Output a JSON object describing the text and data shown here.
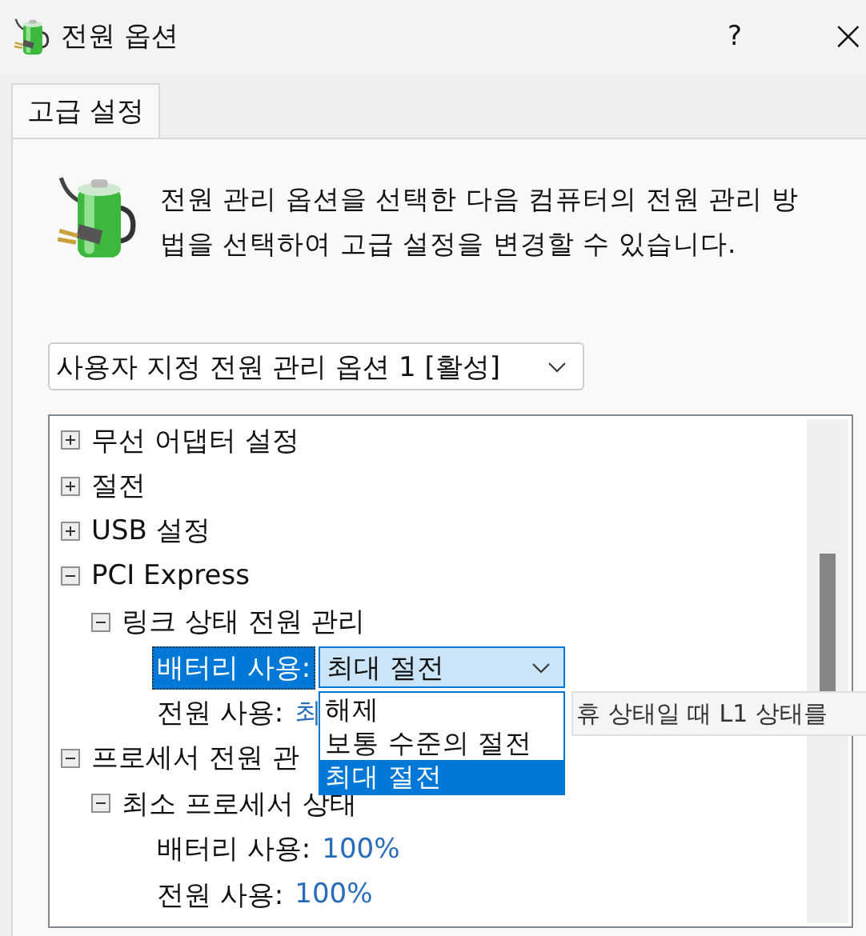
{
  "window": {
    "title": "전원 옵션",
    "help": "?",
    "close": "×"
  },
  "tabs": [
    {
      "label": "고급 설정",
      "selected": true
    }
  ],
  "description": "전원 관리 옵션을 선택한 다음 컴퓨터의 전원 관리 방법을 선택하여 고급 설정을 변경할 수 있습니다.",
  "plan_select": {
    "value": "사용자 지정 전원 관리 옵션 1 [활성]"
  },
  "tree": {
    "items": [
      {
        "kind": "group",
        "label": "무선 어댑터 설정",
        "expanded": false
      },
      {
        "kind": "group",
        "label": "절전",
        "expanded": false
      },
      {
        "kind": "group",
        "label": "USB 설정",
        "expanded": false
      },
      {
        "kind": "group",
        "label": "PCI Express",
        "expanded": true,
        "children": [
          {
            "kind": "group",
            "label": "링크 상태 전원 관리",
            "expanded": true,
            "children": [
              {
                "kind": "choice",
                "label": "배터리 사용:",
                "value": "최대 절전",
                "selected": true,
                "options": [
                  {
                    "label": "해제",
                    "selected": false
                  },
                  {
                    "label": "보통 수준의 절전",
                    "selected": false
                  },
                  {
                    "label": "최대 절전",
                    "selected": true
                  }
                ]
              },
              {
                "kind": "setting",
                "label": "전원 사용:",
                "value": "최",
                "selected": false,
                "tooltip": "휴 상태일 때 L1 상태를"
              }
            ]
          }
        ]
      },
      {
        "kind": "group",
        "label": "프로세서 전원 관",
        "expanded": true,
        "children": [
          {
            "kind": "group",
            "label": "최소 프로세서 상태",
            "expanded": true,
            "children": [
              {
                "kind": "setting",
                "label": "배터리 사용:",
                "value": "100%",
                "selected": false
              },
              {
                "kind": "setting",
                "label": "전원 사용:",
                "value": "100%",
                "selected": false
              }
            ]
          }
        ]
      }
    ]
  }
}
